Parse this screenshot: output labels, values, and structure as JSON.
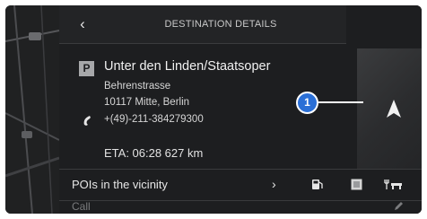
{
  "header": {
    "title": "DESTINATION DETAILS",
    "back_icon": "chevron-left-icon"
  },
  "destination": {
    "badge": "P",
    "name": "Unter den Linden/Staatsoper",
    "street": "Behrenstrasse",
    "postal_city": "10117 Mitte, Berlin",
    "phone": "+(49)-211-384279300",
    "eta": "ETA: 06:28 627 km"
  },
  "callout": {
    "number": "1"
  },
  "pois": {
    "label": "POIs in the vicinity",
    "chevron": "›",
    "icons": [
      "fuel-station-icon",
      "parking-icon",
      "restaurant-icon"
    ]
  },
  "call": {
    "label": "Call"
  },
  "colors": {
    "panel": "#1d1e20",
    "callout": "#2a6fd6",
    "text": "#e6e6e6"
  }
}
